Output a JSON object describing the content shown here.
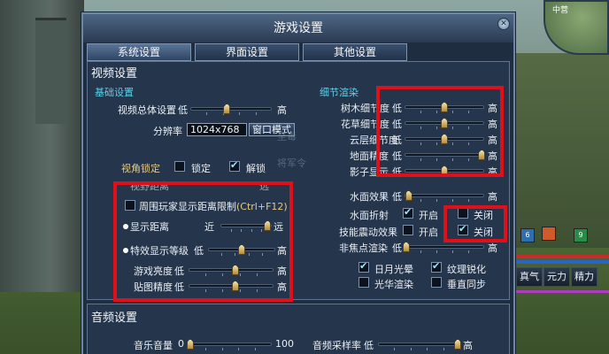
{
  "window": {
    "title": "游戏设置",
    "close_glyph": "✕"
  },
  "tabs": [
    {
      "label": "系统设置",
      "active": true
    },
    {
      "label": "界面设置",
      "active": false
    },
    {
      "label": "其他设置",
      "active": false
    }
  ],
  "video": {
    "section_title": "视频设置",
    "basic": {
      "title": "基础设置",
      "overall_quality": {
        "label": "视频总体设置",
        "low": "低",
        "high": "高",
        "value": 0.45
      },
      "resolution": {
        "label": "分辨率",
        "value": "1024x768",
        "mode_button": "窗口模式"
      },
      "camera_lock": {
        "label": "视角锁定",
        "lock": "锁定",
        "unlock": "解锁",
        "lock_checked": false,
        "unlock_checked": true
      },
      "view_distance": {
        "label": "视野距离",
        "near": "近",
        "far": "远"
      }
    },
    "nearby_limit": {
      "label": "周围玩家显示距离限制",
      "hotkey": "(Ctrl+F12)",
      "checked": false
    },
    "display_distance": {
      "label": "显示距离",
      "near": "近",
      "far": "远",
      "value": 0.92
    },
    "effect_level": {
      "label": "特效显示等级",
      "low": "低",
      "high": "高",
      "value": 0.5
    },
    "brightness": {
      "label": "游戏亮度",
      "low": "低",
      "high": "高",
      "value": 0.55
    },
    "texture": {
      "label": "贴图精度",
      "low": "低",
      "high": "高",
      "value": 0.55
    },
    "detail": {
      "title": "细节渲染",
      "rows": [
        {
          "label": "树木细节度",
          "low": "低",
          "high": "高",
          "value": 0.5
        },
        {
          "label": "花草细节度",
          "low": "低",
          "high": "高",
          "value": 0.5
        },
        {
          "label": "云层细节度",
          "low": "低",
          "high": "高",
          "value": 0.5
        },
        {
          "label": "地面精度",
          "low": "低",
          "high": "高",
          "value": 0.97
        },
        {
          "label": "影子显示",
          "low": "低",
          "high": "高",
          "value": 0.5
        }
      ],
      "water_effect": {
        "label": "水面效果",
        "low": "低",
        "high": "高",
        "value": 0.05
      },
      "water_reflect": {
        "label": "水面折射",
        "on": "开启",
        "off": "关闭",
        "on_checked": true,
        "off_checked": false
      },
      "skill_shake": {
        "label": "技能震动效果",
        "on": "开启",
        "off": "关闭",
        "on_checked": false,
        "off_checked": true
      },
      "dof": {
        "label": "非焦点渲染",
        "low": "低",
        "high": "高",
        "value": 0.02
      },
      "sun_glare": {
        "label": "日月光晕",
        "checked": true
      },
      "texture_sharpen": {
        "label": "纹理锐化",
        "checked": true
      },
      "light_render": {
        "label": "光华渲染",
        "checked": false
      },
      "vsync": {
        "label": "垂直同步",
        "checked": false
      }
    }
  },
  "audio": {
    "section_title": "音频设置",
    "music_volume": {
      "label": "音乐音量",
      "min": "0",
      "max": "100",
      "value": 0.02
    },
    "sample_rate": {
      "label": "音频采样率",
      "low": "低",
      "high": "高",
      "value": 0.98
    }
  },
  "hud": {
    "skills": [
      "真气",
      "元力",
      "精力"
    ],
    "counts": [
      "6",
      "9"
    ],
    "minimap_label": "中营"
  },
  "colors": {
    "highlight_box": "#e0101a",
    "accent_text": "#5cd0ea"
  }
}
